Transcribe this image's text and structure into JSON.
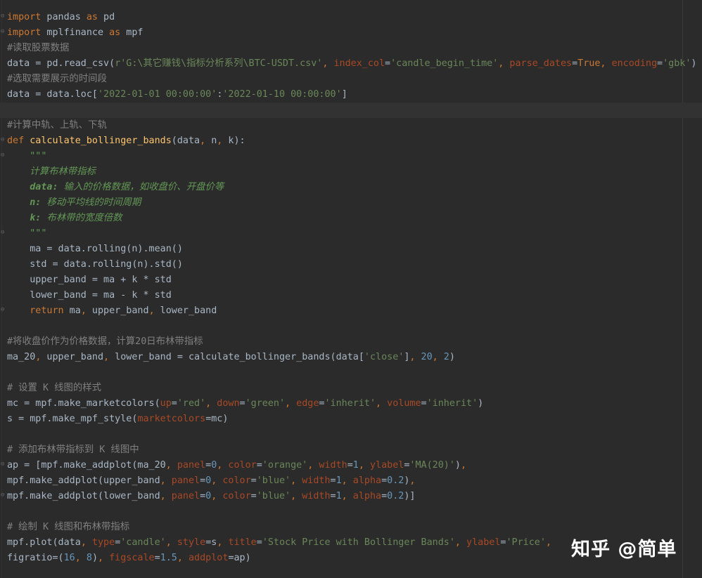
{
  "editor": {
    "lines": [
      "import pandas as pd",
      "import mplfinance as mpf",
      "#读取股票数据",
      "data = pd.read_csv(r'G:\\其它赚钱\\指标分析系列\\BTC-USDT.csv', index_col='candle_begin_time', parse_dates=True, encoding='gbk')",
      "#选取需要展示的时间段",
      "data = data.loc['2022-01-01 00:00:00':'2022-01-10 00:00:00']",
      "",
      "#计算中轨、上轨、下轨",
      "def calculate_bollinger_bands(data, n, k):",
      "    \"\"\"",
      "    计算布林带指标",
      "    data: 输入的价格数据，如收盘价、开盘价等",
      "    n: 移动平均线的时间周期",
      "    k: 布林带的宽度倍数",
      "    \"\"\"",
      "    ma = data.rolling(n).mean()",
      "    std = data.rolling(n).std()",
      "    upper_band = ma + k * std",
      "    lower_band = ma - k * std",
      "    return ma, upper_band, lower_band",
      "",
      "#将收盘价作为价格数据，计算20日布林带指标",
      "ma_20, upper_band, lower_band = calculate_bollinger_bands(data['close'], 20, 2)",
      "",
      "# 设置 K 线图的样式",
      "mc = mpf.make_marketcolors(up='red', down='green', edge='inherit', volume='inherit')",
      "s = mpf.make_mpf_style(marketcolors=mc)",
      "",
      "# 添加布林带指标到 K 线图中",
      "ap = [mpf.make_addplot(ma_20, panel=0, color='orange', width=1, ylabel='MA(20)'),",
      "mpf.make_addplot(upper_band, panel=0, color='blue', width=1, alpha=0.2),",
      "mpf.make_addplot(lower_band, panel=0, color='blue', width=1, alpha=0.2)]",
      "",
      "# 绘制 K 线图和布林带指标",
      "mpf.plot(data, type='candle', style=s, title='Stock Price with Bollinger Bands', ylabel='Price',",
      "figratio=(16, 8), figscale=1.5, addplot=ap)"
    ]
  },
  "watermark": "知乎 @简单",
  "colors": {
    "background": "#2b2b2b",
    "keyword": "#cc7832",
    "string": "#6a8759",
    "comment": "#808080",
    "function": "#ffc66d",
    "number": "#6897bb",
    "param": "#aa4926",
    "docstring": "#629755"
  }
}
